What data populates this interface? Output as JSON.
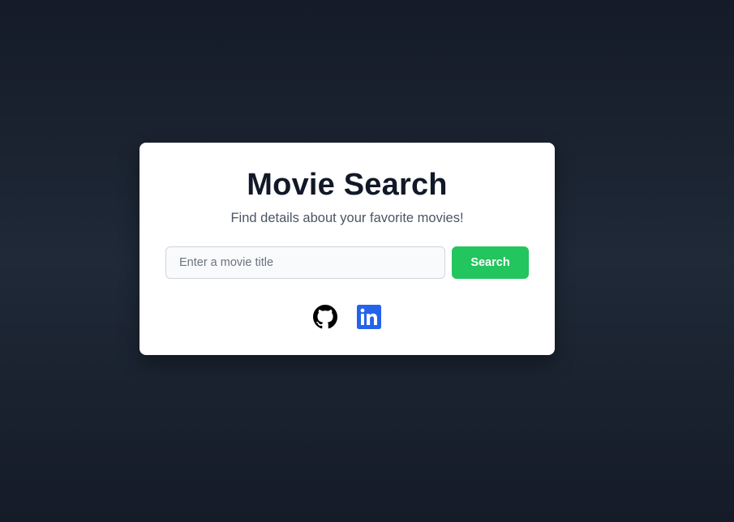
{
  "card": {
    "title": "Movie Search",
    "subtitle": "Find details about your favorite movies!"
  },
  "search": {
    "placeholder": "Enter a movie title",
    "value": "",
    "button_label": "Search"
  },
  "social": {
    "links": [
      {
        "icon": "github-icon",
        "color": "#000000"
      },
      {
        "icon": "linkedin-icon",
        "color": "#2563eb"
      }
    ]
  },
  "colors": {
    "accent": "#22c55e",
    "title": "#111827",
    "subtitle": "#4b5563",
    "background": "#1f2937",
    "linkedin": "#2563eb"
  }
}
